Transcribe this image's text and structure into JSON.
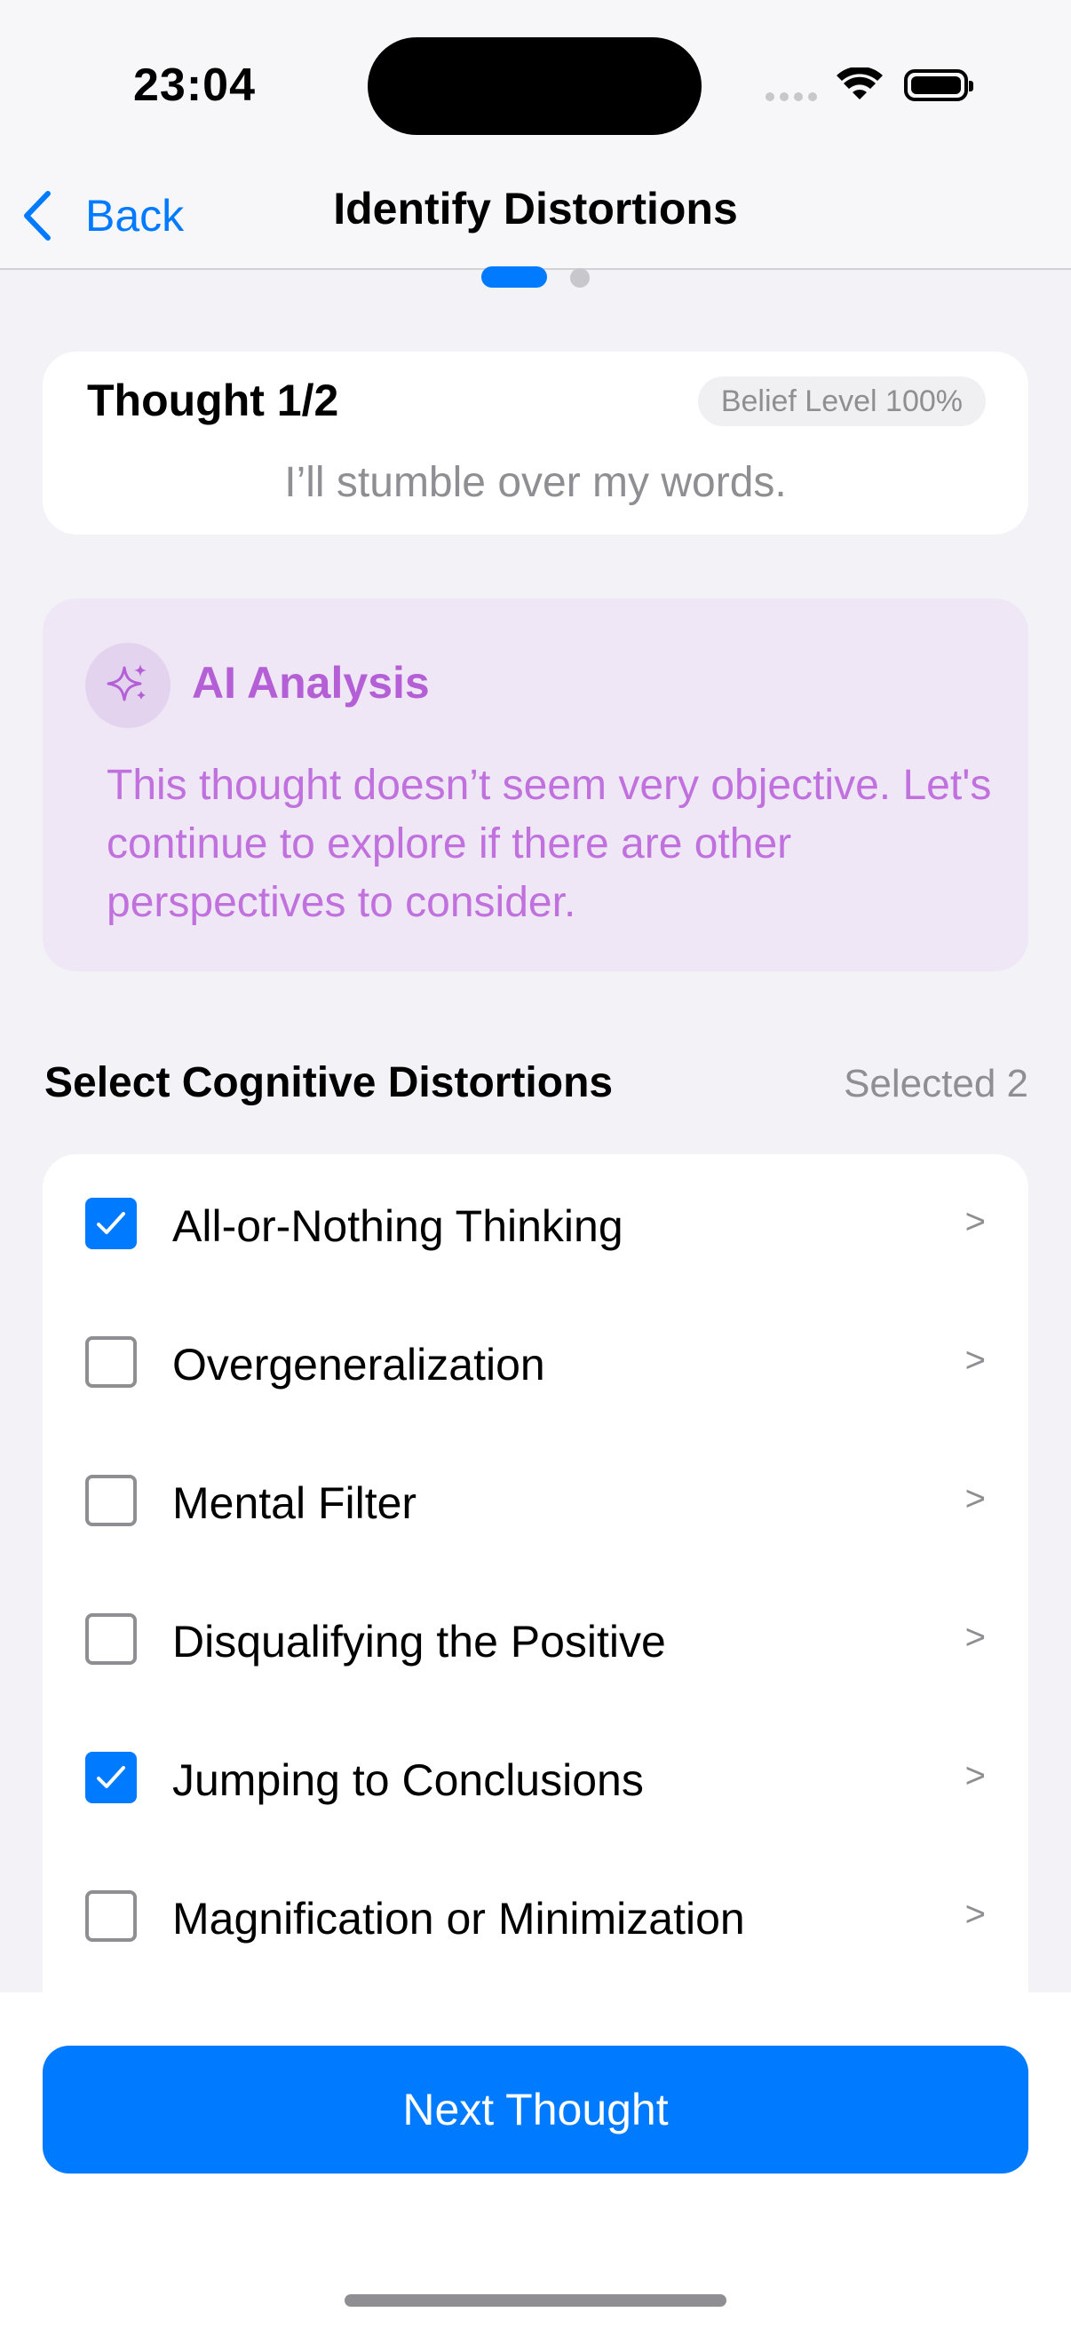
{
  "status_bar": {
    "time": "23:04",
    "icons": [
      "cellular-signal-icon",
      "wifi-icon",
      "battery-icon"
    ]
  },
  "navigation": {
    "back_label": "Back",
    "title": "Identify Distortions"
  },
  "pager": {
    "current_page": 1,
    "total_pages": 2
  },
  "thought_card": {
    "title": "Thought 1/2",
    "belief_level": "Belief Level 100%",
    "thought": "I’ll stumble over my words."
  },
  "ai_analysis": {
    "title": "AI Analysis",
    "text": "This thought doesn’t seem very objective. Let's continue to explore if there are other perspectives to consider.",
    "icon": "sparkles-icon"
  },
  "distortions_section": {
    "title": "Select Cognitive Distortions",
    "selected_count": "Selected 2",
    "items": [
      {
        "label": "All-or-Nothing Thinking",
        "checked": true,
        "chevron": ">"
      },
      {
        "label": "Overgeneralization",
        "checked": false,
        "chevron": ">"
      },
      {
        "label": "Mental Filter",
        "checked": false,
        "chevron": ">"
      },
      {
        "label": "Disqualifying the Positive",
        "checked": false,
        "chevron": ">"
      },
      {
        "label": "Jumping to Conclusions",
        "checked": true,
        "chevron": ">"
      },
      {
        "label": "Magnification or Minimization",
        "checked": false,
        "chevron": ">"
      }
    ]
  },
  "bottom": {
    "next_button": "Next Thought"
  },
  "colors": {
    "accent": "#007aff",
    "ai_purple": "#b45fd6",
    "ai_background": "#efe7f6",
    "background": "#f2f2f7"
  }
}
